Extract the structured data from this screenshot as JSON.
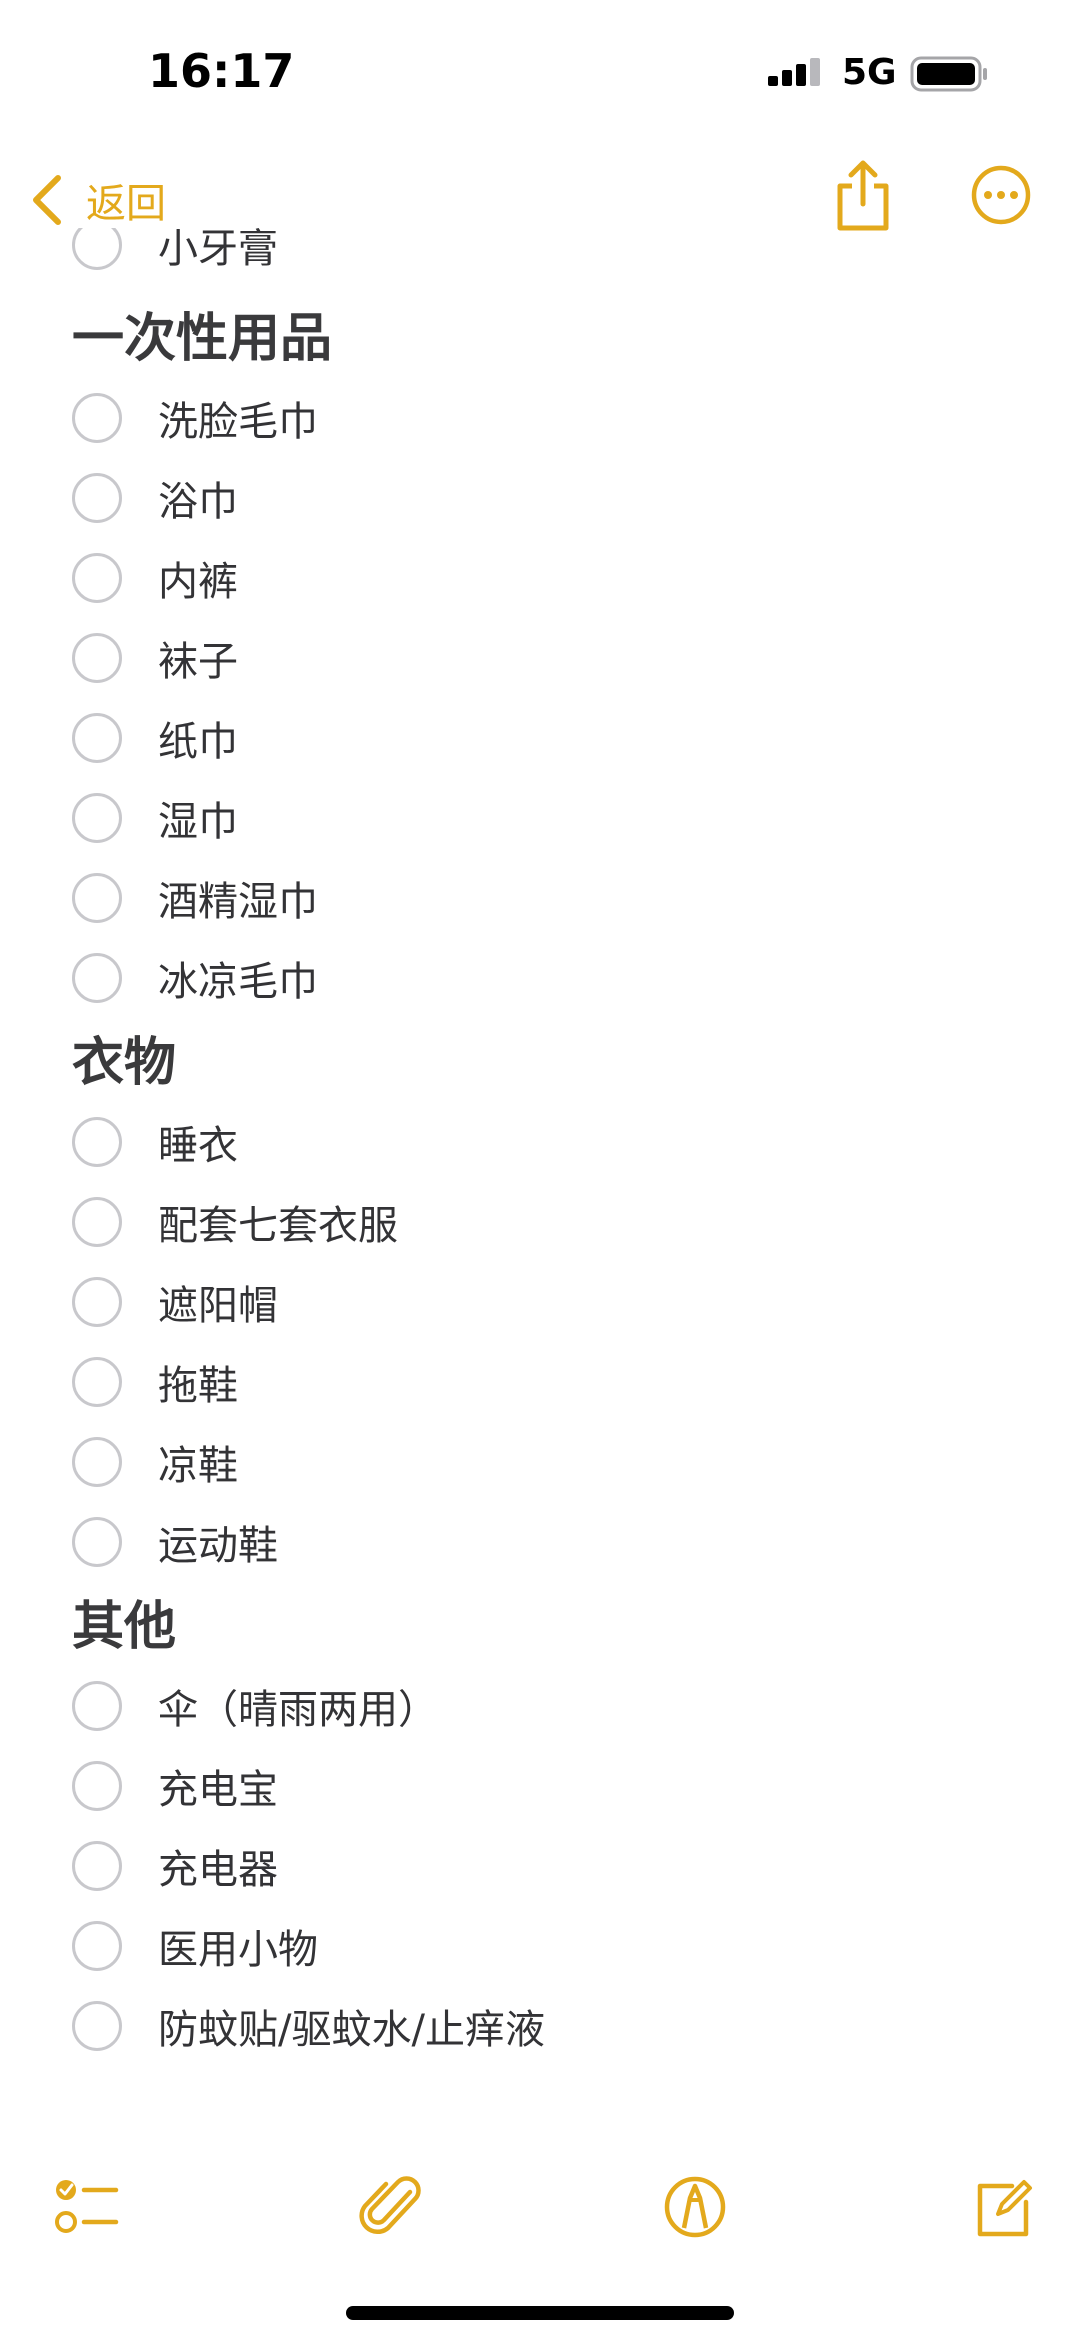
{
  "status_bar": {
    "time": "16:17",
    "network": "5G"
  },
  "nav": {
    "back_label": "返回"
  },
  "colors": {
    "accent": "#e3a91c",
    "checkbox": "#c8c8cc"
  },
  "note": {
    "partial_item": "小牙膏",
    "sections": [
      {
        "heading": "一次性用品",
        "items": [
          "洗脸毛巾",
          "浴巾",
          "内裤",
          "袜子",
          "纸巾",
          "湿巾",
          "酒精湿巾",
          "冰凉毛巾"
        ]
      },
      {
        "heading": "衣物",
        "items": [
          "睡衣",
          "配套七套衣服",
          "遮阳帽",
          "拖鞋",
          "凉鞋",
          "运动鞋"
        ]
      },
      {
        "heading": "其他",
        "items": [
          "伞（晴雨两用）",
          "充电宝",
          "充电器",
          "医用小物",
          "防蚊贴/驱蚊水/止痒液"
        ]
      }
    ]
  },
  "toolbar": {
    "icons": [
      "checklist-icon",
      "paperclip-icon",
      "markup-pen-icon",
      "compose-icon"
    ]
  }
}
